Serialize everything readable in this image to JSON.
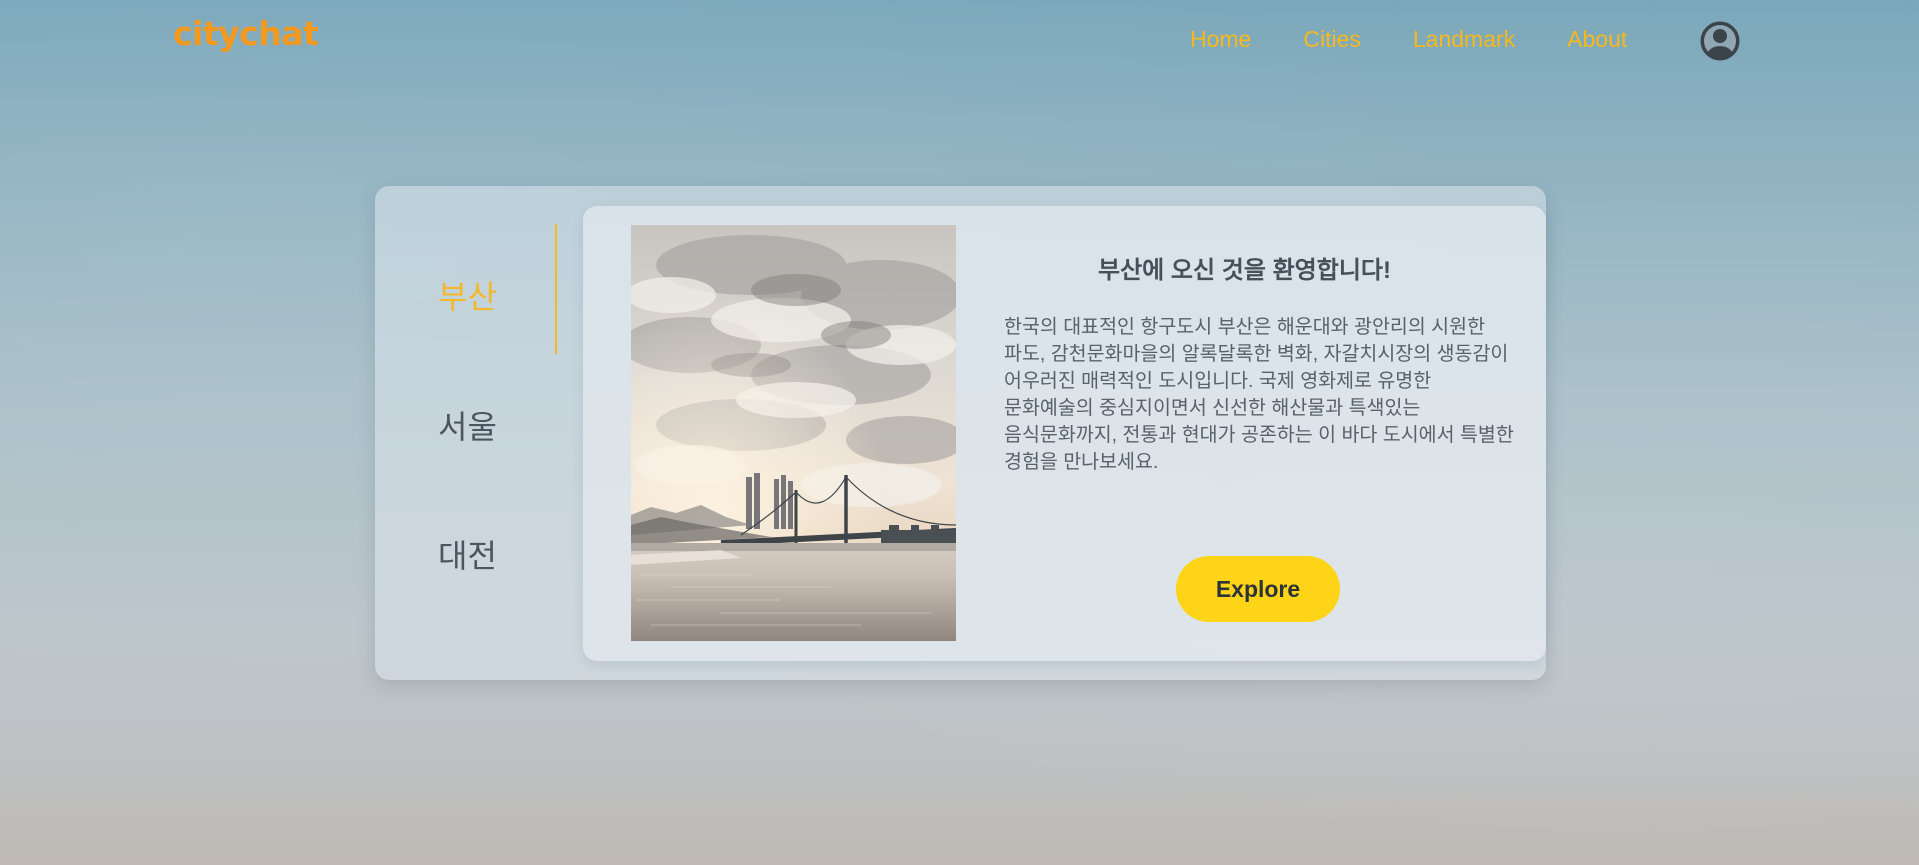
{
  "header": {
    "logo": "citychat",
    "nav": {
      "home": "Home",
      "cities": "Cities",
      "landmark": "Landmark",
      "about": "About"
    },
    "profile_icon": "user-circle-icon"
  },
  "sidebar": {
    "tabs": [
      {
        "label": "부산",
        "active": true
      },
      {
        "label": "서울",
        "active": false
      },
      {
        "label": "대전",
        "active": false
      }
    ]
  },
  "main": {
    "title": "부산에 오신 것을 환영합니다!",
    "description": "한국의 대표적인 항구도시 부산은 해운대와 광안리의 시원한 파도, 감천문화마을의 알록달록한 벽화, 자갈치시장의 생동감이 어우러진 매력적인 도시입니다. 국제 영화제로 유명한 문화예술의 중심지이면서 신선한 해산물과 특색있는 음식문화까지, 전통과 현대가 공존하는 이 바다 도시에서 특별한 경험을 만나보세요.",
    "explore_label": "Explore"
  },
  "colors": {
    "brand": "#f39a1e",
    "nav": "#f7b81c",
    "active_tab": "#f3b92b",
    "button": "#fdd418"
  }
}
